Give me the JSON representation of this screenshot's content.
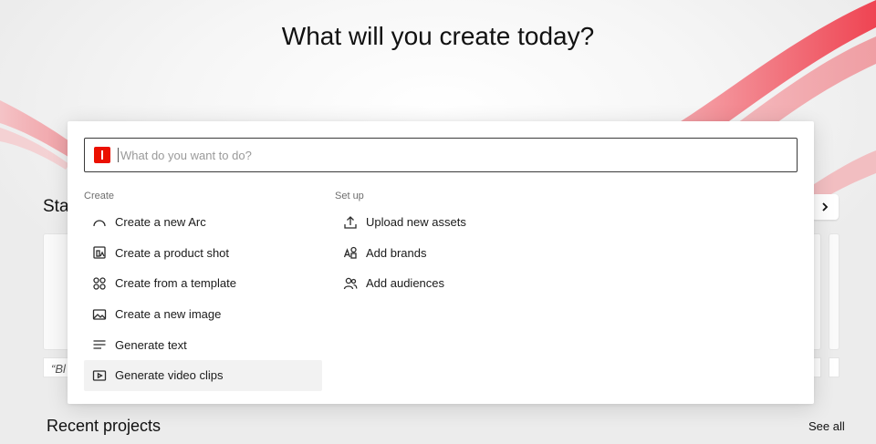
{
  "hero": {
    "title": "What will you create today?"
  },
  "background": {
    "section_label": "Sta",
    "quote_snippet": "“Bl",
    "recent_title": "Recent projects",
    "see_all": "See all"
  },
  "palette": {
    "search": {
      "placeholder": "What do you want to do?",
      "value": ""
    },
    "create": {
      "heading": "Create",
      "items": [
        {
          "label": "Create a new Arc",
          "icon": "arc-icon"
        },
        {
          "label": "Create a product shot",
          "icon": "product-shot-icon"
        },
        {
          "label": "Create from a template",
          "icon": "template-grid-icon"
        },
        {
          "label": "Create a new image",
          "icon": "image-icon"
        },
        {
          "label": "Generate text",
          "icon": "text-lines-icon"
        },
        {
          "label": "Generate video clips",
          "icon": "video-icon"
        }
      ]
    },
    "setup": {
      "heading": "Set up",
      "items": [
        {
          "label": "Upload new assets",
          "icon": "upload-icon"
        },
        {
          "label": "Add brands",
          "icon": "brands-icon"
        },
        {
          "label": "Add audiences",
          "icon": "audiences-icon"
        }
      ]
    }
  },
  "colors": {
    "brand": "#eb1000",
    "ribbon": "#f05a64"
  }
}
